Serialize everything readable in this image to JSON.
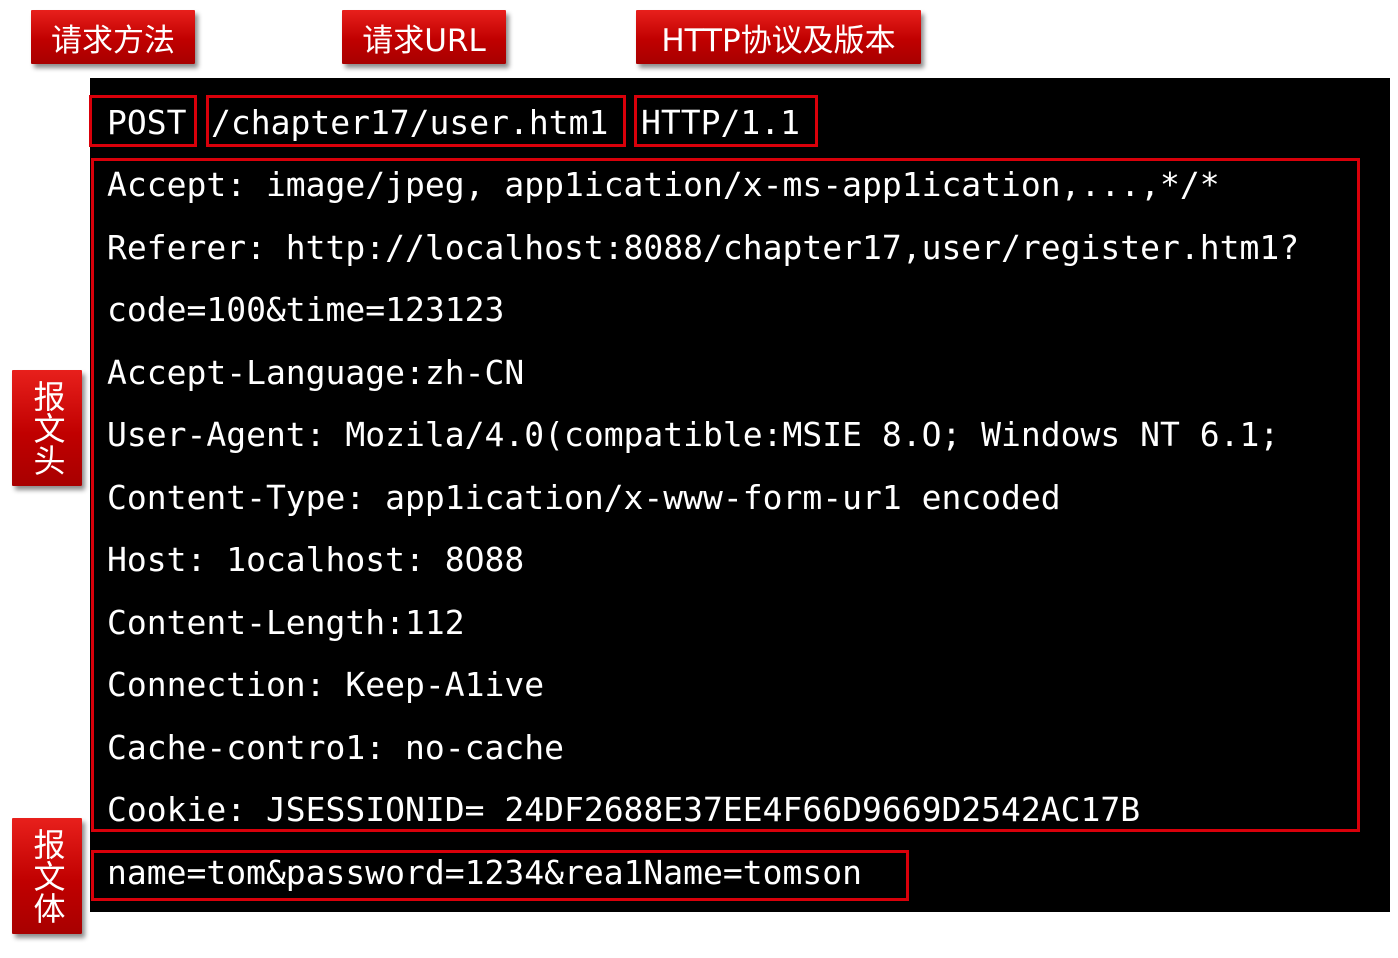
{
  "labels": {
    "method": "请求方法",
    "url": "请求URL",
    "protocol": "HTTP协议及版本",
    "header": "报文头",
    "body": "报文体"
  },
  "request_line": {
    "method": "POST",
    "url": "/chapter17/user.htm1",
    "version": "HTTP/1.1"
  },
  "header_lines": [
    "Accept: image/jpeg, app1ication/x-ms-app1ication,...,*/*",
    "Referer: http://localhost:8088/chapter17,user/register.htm1?",
    "code=100&time=123123",
    "Accept-Language:zh-CN",
    "User-Agent: Mozila/4.0(compatible:MSIE 8.O; Windows NT 6.1;",
    "Content-Type: app1ication/x-www-form-ur1 encoded",
    "Host: 1ocalhost: 8O88",
    "Content-Length:112",
    "Connection: Keep-A1ive",
    "Cache-contro1: no-cache",
    "Cookie: JSESSIONID= 24DF2688E37EE4F66D9669D2542AC17B"
  ],
  "body_line": "name=tom&password=1234&rea1Name=tomson",
  "colors": {
    "label_red": "#c00000",
    "box_red": "#d9000a",
    "panel": "#000000",
    "text": "#ffffff"
  }
}
